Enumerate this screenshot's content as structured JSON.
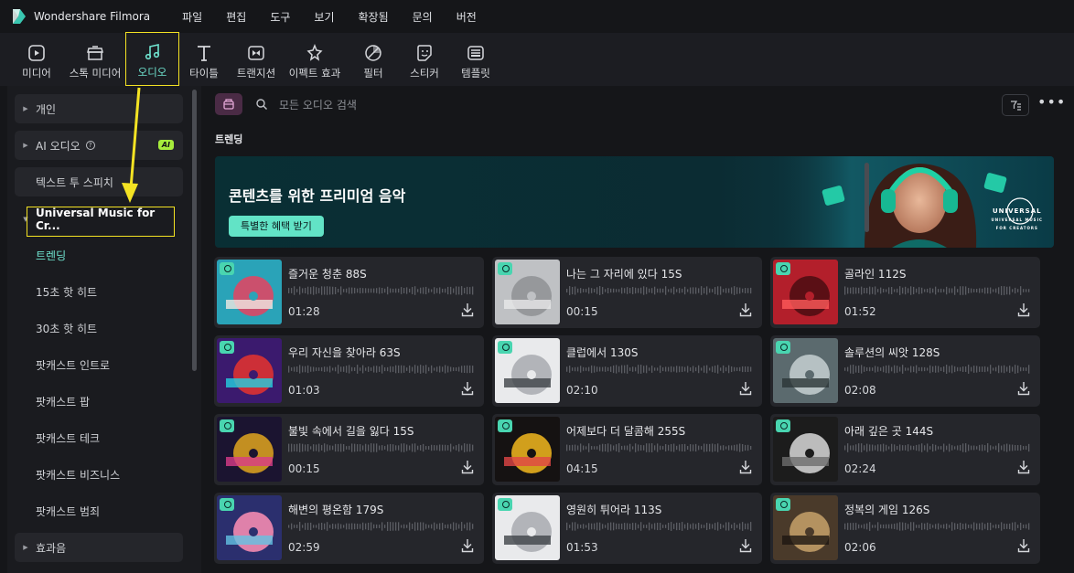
{
  "app": {
    "name": "Wondershare Filmora"
  },
  "menu": [
    "파일",
    "편집",
    "도구",
    "보기",
    "확장됨",
    "문의",
    "버전"
  ],
  "toolbar": {
    "tabs": [
      {
        "label": "미디어",
        "icon": "media-icon"
      },
      {
        "label": "스톡 미디어",
        "icon": "stock-media-icon"
      },
      {
        "label": "오디오",
        "icon": "audio-icon",
        "active": true
      },
      {
        "label": "타이틀",
        "icon": "title-icon"
      },
      {
        "label": "트랜지션",
        "icon": "transition-icon"
      },
      {
        "label": "이펙트 효과",
        "icon": "effects-icon"
      },
      {
        "label": "필터",
        "icon": "filter-icon"
      },
      {
        "label": "스티커",
        "icon": "sticker-icon"
      },
      {
        "label": "템플릿",
        "icon": "template-icon"
      }
    ]
  },
  "sidebar": {
    "items": [
      {
        "label": "개인"
      },
      {
        "label": "AI 오디오",
        "badge": "AI"
      },
      {
        "label": "텍스트 투 스피치"
      },
      {
        "label": "Universal Music for Cr..."
      },
      {
        "label": "트렌딩"
      },
      {
        "label": "15초 핫 히트"
      },
      {
        "label": "30초 핫 히트"
      },
      {
        "label": "팟캐스트 인트로"
      },
      {
        "label": "팟캐스트 팝"
      },
      {
        "label": "팟캐스트 테크"
      },
      {
        "label": "팟캐스트 비즈니스"
      },
      {
        "label": "팟캐스트 범죄"
      },
      {
        "label": "효과음"
      }
    ]
  },
  "search": {
    "placeholder": "모든 오디오 검색"
  },
  "section": {
    "title": "트렌딩"
  },
  "banner": {
    "title": "콘텐츠를 위한 프리미엄 음악",
    "button": "특별한 혜택 받기",
    "brand_line1": "UNIVERSAL",
    "brand_line2": "UNIVERSAL MUSIC",
    "brand_line3": "FOR CREATORS"
  },
  "tracks": [
    {
      "title": "즐거운 청춘 88S",
      "duration": "01:28",
      "art": "TIN ADVERTISING"
    },
    {
      "title": "나는 그 자리에 있다 15S",
      "duration": "00:15",
      "art": "BEAST MODE"
    },
    {
      "title": "골라인 112S",
      "duration": "01:52",
      "art": "FAST TRAP"
    },
    {
      "title": "우리 자신을 찾아라 63S",
      "duration": "01:03",
      "art": "ELEVATE"
    },
    {
      "title": "클럽에서 130S",
      "duration": "02:10",
      "art": "90s DANCE REVIVAL"
    },
    {
      "title": "솔루션의 씨앗 128S",
      "duration": "02:08",
      "art": "LIFTED"
    },
    {
      "title": "불빛 속에서 길을 잃다 15S",
      "duration": "00:15",
      "art": "DEEP HOUSE EDM HITS"
    },
    {
      "title": "어제보다 더 달콤해 255S",
      "duration": "04:15",
      "art": "HIP-HOP SOUL"
    },
    {
      "title": "아래 깊은 곳 144S",
      "duration": "02:24",
      "art": "UNDERCURRENT"
    },
    {
      "title": "해변의 평온함 179S",
      "duration": "02:59",
      "art": "INSPIRATIONAL"
    },
    {
      "title": "영원히 튀어라 113S",
      "duration": "01:53",
      "art": "90s DANCE REVIVAL"
    },
    {
      "title": "정복의 게임 126S",
      "duration": "02:06",
      "art": "GAME THEORY"
    }
  ],
  "colors": {
    "accent": "#6fe3cf",
    "highlight": "#f4e323",
    "card": "#25262b",
    "bg": "#151619"
  }
}
